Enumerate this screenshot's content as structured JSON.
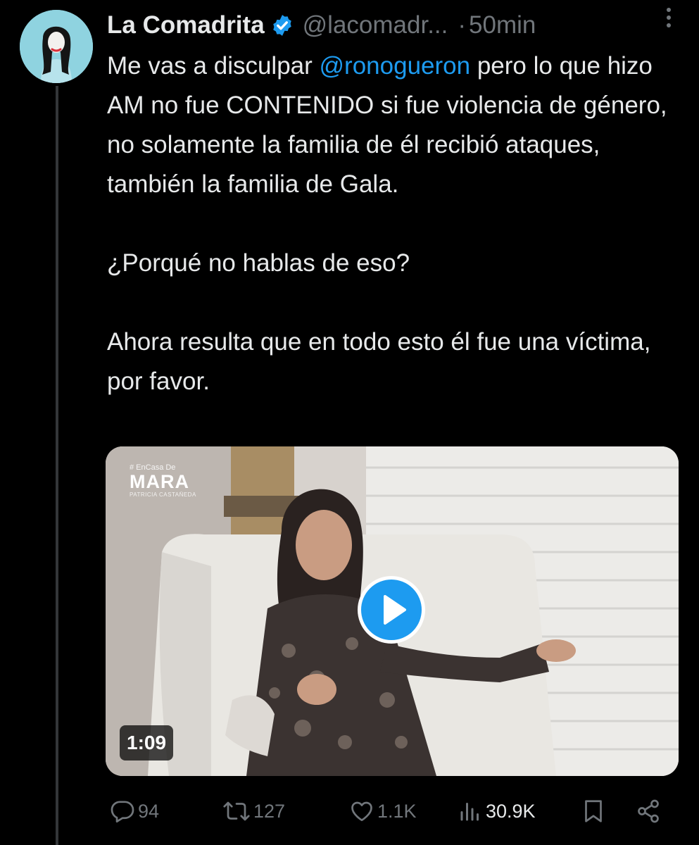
{
  "tweet": {
    "display_name": "La Comadrita",
    "verified": true,
    "handle": "@lacomadr...",
    "separator": "·",
    "time": "50min",
    "text": {
      "line1_prefix": "Me vas a disculpar ",
      "mention": "@ronogueron",
      "line1_suffix": " pero lo que hizo AM no fue CONTENIDO si fue violencia de género, no solamente la familia de él recibió ataques, también la familia de Gala.",
      "paragraph2": "¿Porqué no hablas de eso?",
      "paragraph3": "Ahora resulta que en todo esto él fue una víctima, por favor."
    }
  },
  "media": {
    "type": "video",
    "duration": "1:09",
    "overlay_brand": {
      "top": "# EnCasa De",
      "main": "MARA",
      "sub": "PATRICIA CASTAÑEDA"
    }
  },
  "actions": {
    "replies": "94",
    "reposts": "127",
    "likes": "1.1K",
    "views": "30.9K"
  },
  "icons": {
    "verified": "verified-badge-icon",
    "more": "more-options-icon",
    "reply": "reply-icon",
    "repost": "repost-icon",
    "like": "heart-icon",
    "views": "views-icon",
    "bookmark": "bookmark-icon",
    "share": "share-icon",
    "play": "play-icon"
  },
  "colors": {
    "background": "#000000",
    "text": "#e7e9ea",
    "secondary": "#71767b",
    "accent": "#1d9bf0"
  }
}
